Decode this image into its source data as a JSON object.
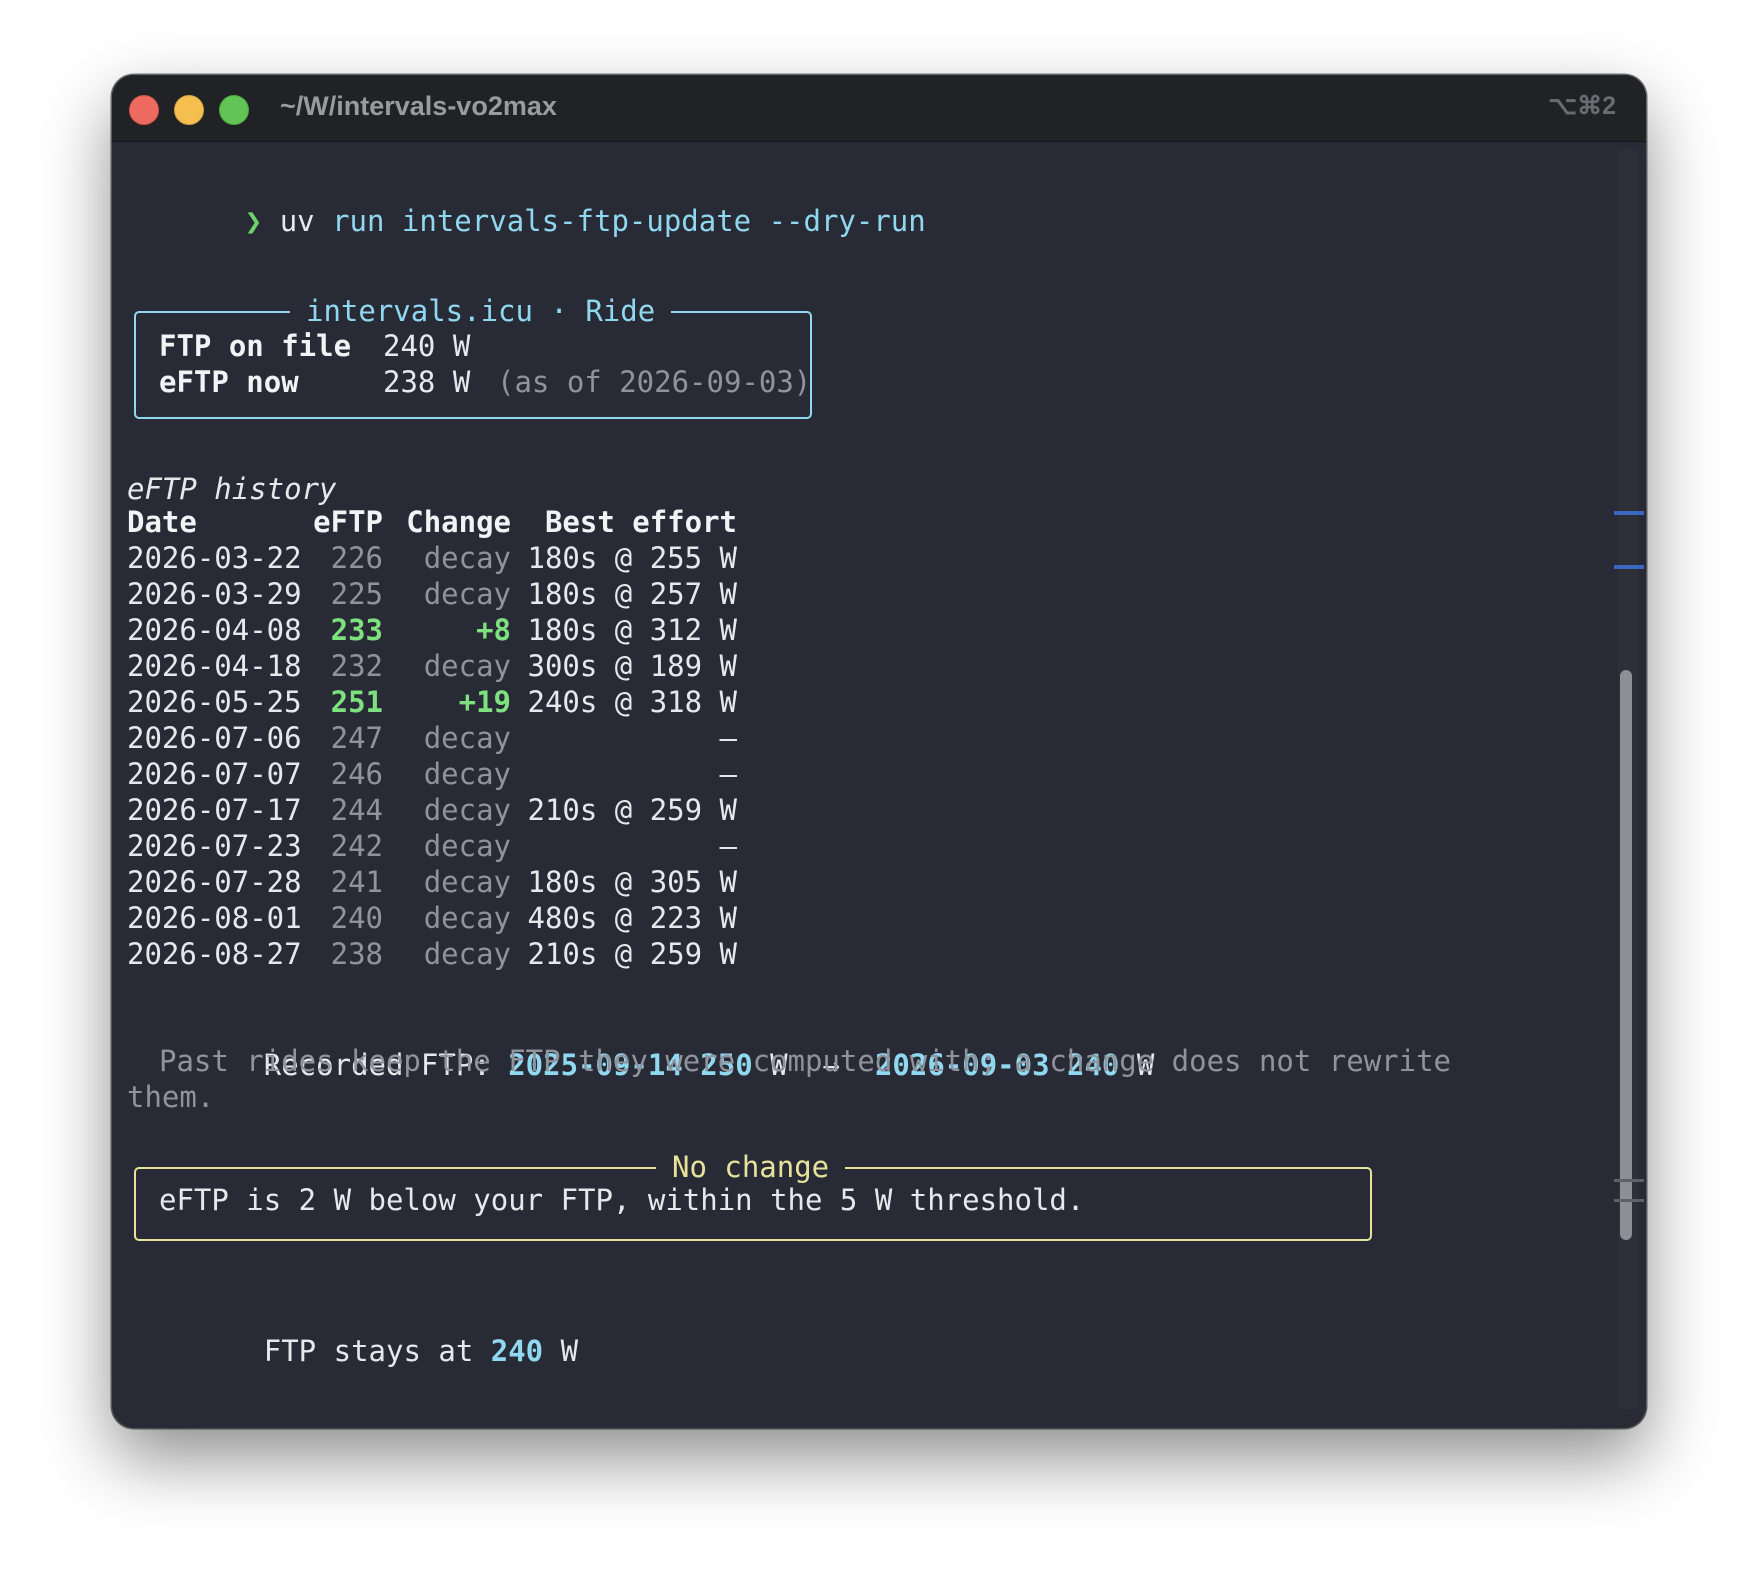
{
  "window": {
    "title": "~/W/intervals-vo2max",
    "shortcut": "⌥⌘2"
  },
  "prompt": {
    "symbol": "❯",
    "cmd": "uv",
    "args": "run intervals-ftp-update --dry-run"
  },
  "summary_box": {
    "title": "intervals.icu · Ride",
    "ftp_label": "FTP on file",
    "ftp_value": "240 W",
    "eftp_label": "eFTP now",
    "eftp_value": "238 W",
    "eftp_note": "(as of 2026-09-03)"
  },
  "history": {
    "heading": "eFTP history",
    "headers": [
      "Date",
      "eFTP",
      "Change",
      "Best effort"
    ],
    "rows": [
      {
        "date": "2026-03-22",
        "eftp": "226",
        "change": "decay",
        "best": "180s @ 255 W",
        "highlight": false
      },
      {
        "date": "2026-03-29",
        "eftp": "225",
        "change": "decay",
        "best": "180s @ 257 W",
        "highlight": false
      },
      {
        "date": "2026-04-08",
        "eftp": "233",
        "change": "+8",
        "best": "180s @ 312 W",
        "highlight": true
      },
      {
        "date": "2026-04-18",
        "eftp": "232",
        "change": "decay",
        "best": "300s @ 189 W",
        "highlight": false
      },
      {
        "date": "2026-05-25",
        "eftp": "251",
        "change": "+19",
        "best": "240s @ 318 W",
        "highlight": true
      },
      {
        "date": "2026-07-06",
        "eftp": "247",
        "change": "decay",
        "best": "—",
        "highlight": false
      },
      {
        "date": "2026-07-07",
        "eftp": "246",
        "change": "decay",
        "best": "—",
        "highlight": false
      },
      {
        "date": "2026-07-17",
        "eftp": "244",
        "change": "decay",
        "best": "210s @ 259 W",
        "highlight": false
      },
      {
        "date": "2026-07-23",
        "eftp": "242",
        "change": "decay",
        "best": "—",
        "highlight": false
      },
      {
        "date": "2026-07-28",
        "eftp": "241",
        "change": "decay",
        "best": "180s @ 305 W",
        "highlight": false
      },
      {
        "date": "2026-08-01",
        "eftp": "240",
        "change": "decay",
        "best": "480s @ 223 W",
        "highlight": false
      },
      {
        "date": "2026-08-27",
        "eftp": "238",
        "change": "decay",
        "best": "210s @ 259 W",
        "highlight": false
      }
    ]
  },
  "recorded": {
    "label": "Recorded FTP:",
    "from_date": "2025-09-14",
    "from_value": "250",
    "unit": "W",
    "arrow": "→",
    "to_date": "2026-09-03",
    "to_value": "240",
    "note_line1": "Past rides keep the FTP they were computed with; a change does not rewrite",
    "note_line2": "them."
  },
  "result_box": {
    "title": "No change",
    "message": "eFTP is 2 W below your FTP, within the 5 W threshold."
  },
  "footer": {
    "prefix": "FTP stays at",
    "value": "240",
    "unit": "W"
  },
  "colors": {
    "background": "#282b36",
    "accent_cyan": "#8fd8f0",
    "positive_green": "#7ee07e",
    "warning_yellow": "#e8e39a"
  }
}
